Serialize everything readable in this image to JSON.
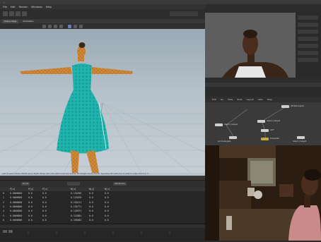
{
  "window": {
    "title": "...",
    "menus": [
      "File",
      "Edit",
      "Render",
      "Windows",
      "Help"
    ]
  },
  "viewport": {
    "tabs": [
      "Scene View",
      "Animation"
    ],
    "status_text": "Left mouse tumbles. Middle pans. Right dollies. Ctrl+Alt+Left mouse box-zooms. Ctrl+Right mouse zooms. Spacebar-Ctrl-Left-click to select a view. Hold S or T..."
  },
  "params": {
    "header_labels": [
      "Scroll",
      "Edit",
      "Attributes"
    ]
  },
  "sheet": {
    "columns": [
      "",
      "P[x]",
      "P[y]",
      "P[z]",
      "N[x]",
      "N[y]",
      "N[z]"
    ],
    "rows": [
      [
        "0",
        "0.0000000",
        "0.0",
        "0.0",
        "0.134956",
        "0.0",
        "0.0"
      ],
      [
        "1",
        "0.0000000",
        "0.0",
        "0.0",
        "0.125876",
        "0.0",
        "0.0"
      ],
      [
        "2",
        "0.0000000",
        "0.0",
        "0.0",
        "0.120111",
        "0.0",
        "0.0"
      ],
      [
        "3",
        "0.0000000",
        "0.0",
        "0.0",
        "0.134771",
        "0.0",
        "0.0"
      ],
      [
        "4",
        "0.0000000",
        "0.0",
        "0.0",
        "0.120571",
        "0.0",
        "0.0"
      ],
      [
        "5",
        "0.0000000",
        "0.0",
        "0.0",
        "0.110881",
        "0.0",
        "0.0"
      ],
      [
        "6",
        "0.0000000",
        "0.0",
        "0.0",
        "0.106001",
        "0.0",
        "0.0"
      ]
    ]
  },
  "network": {
    "menu": [
      "Edit",
      "Go",
      "View",
      "Tools",
      "Layout",
      "Labs",
      "Help"
    ],
    "nodes": [
      {
        "label": "attribwrangle1"
      },
      {
        "label": "object_merge2"
      },
      {
        "label": "object_merge1"
      },
      {
        "label": "OUT"
      },
      {
        "label": "timeshift1"
      },
      {
        "label": "pointwrangle1"
      },
      {
        "label": "object_merge3"
      }
    ]
  },
  "colors": {
    "dress": "#1fb3ad",
    "skin": "#d08a3a",
    "viewport_bg": "#b6c2cb",
    "panel_bg": "#2a2a2a"
  }
}
